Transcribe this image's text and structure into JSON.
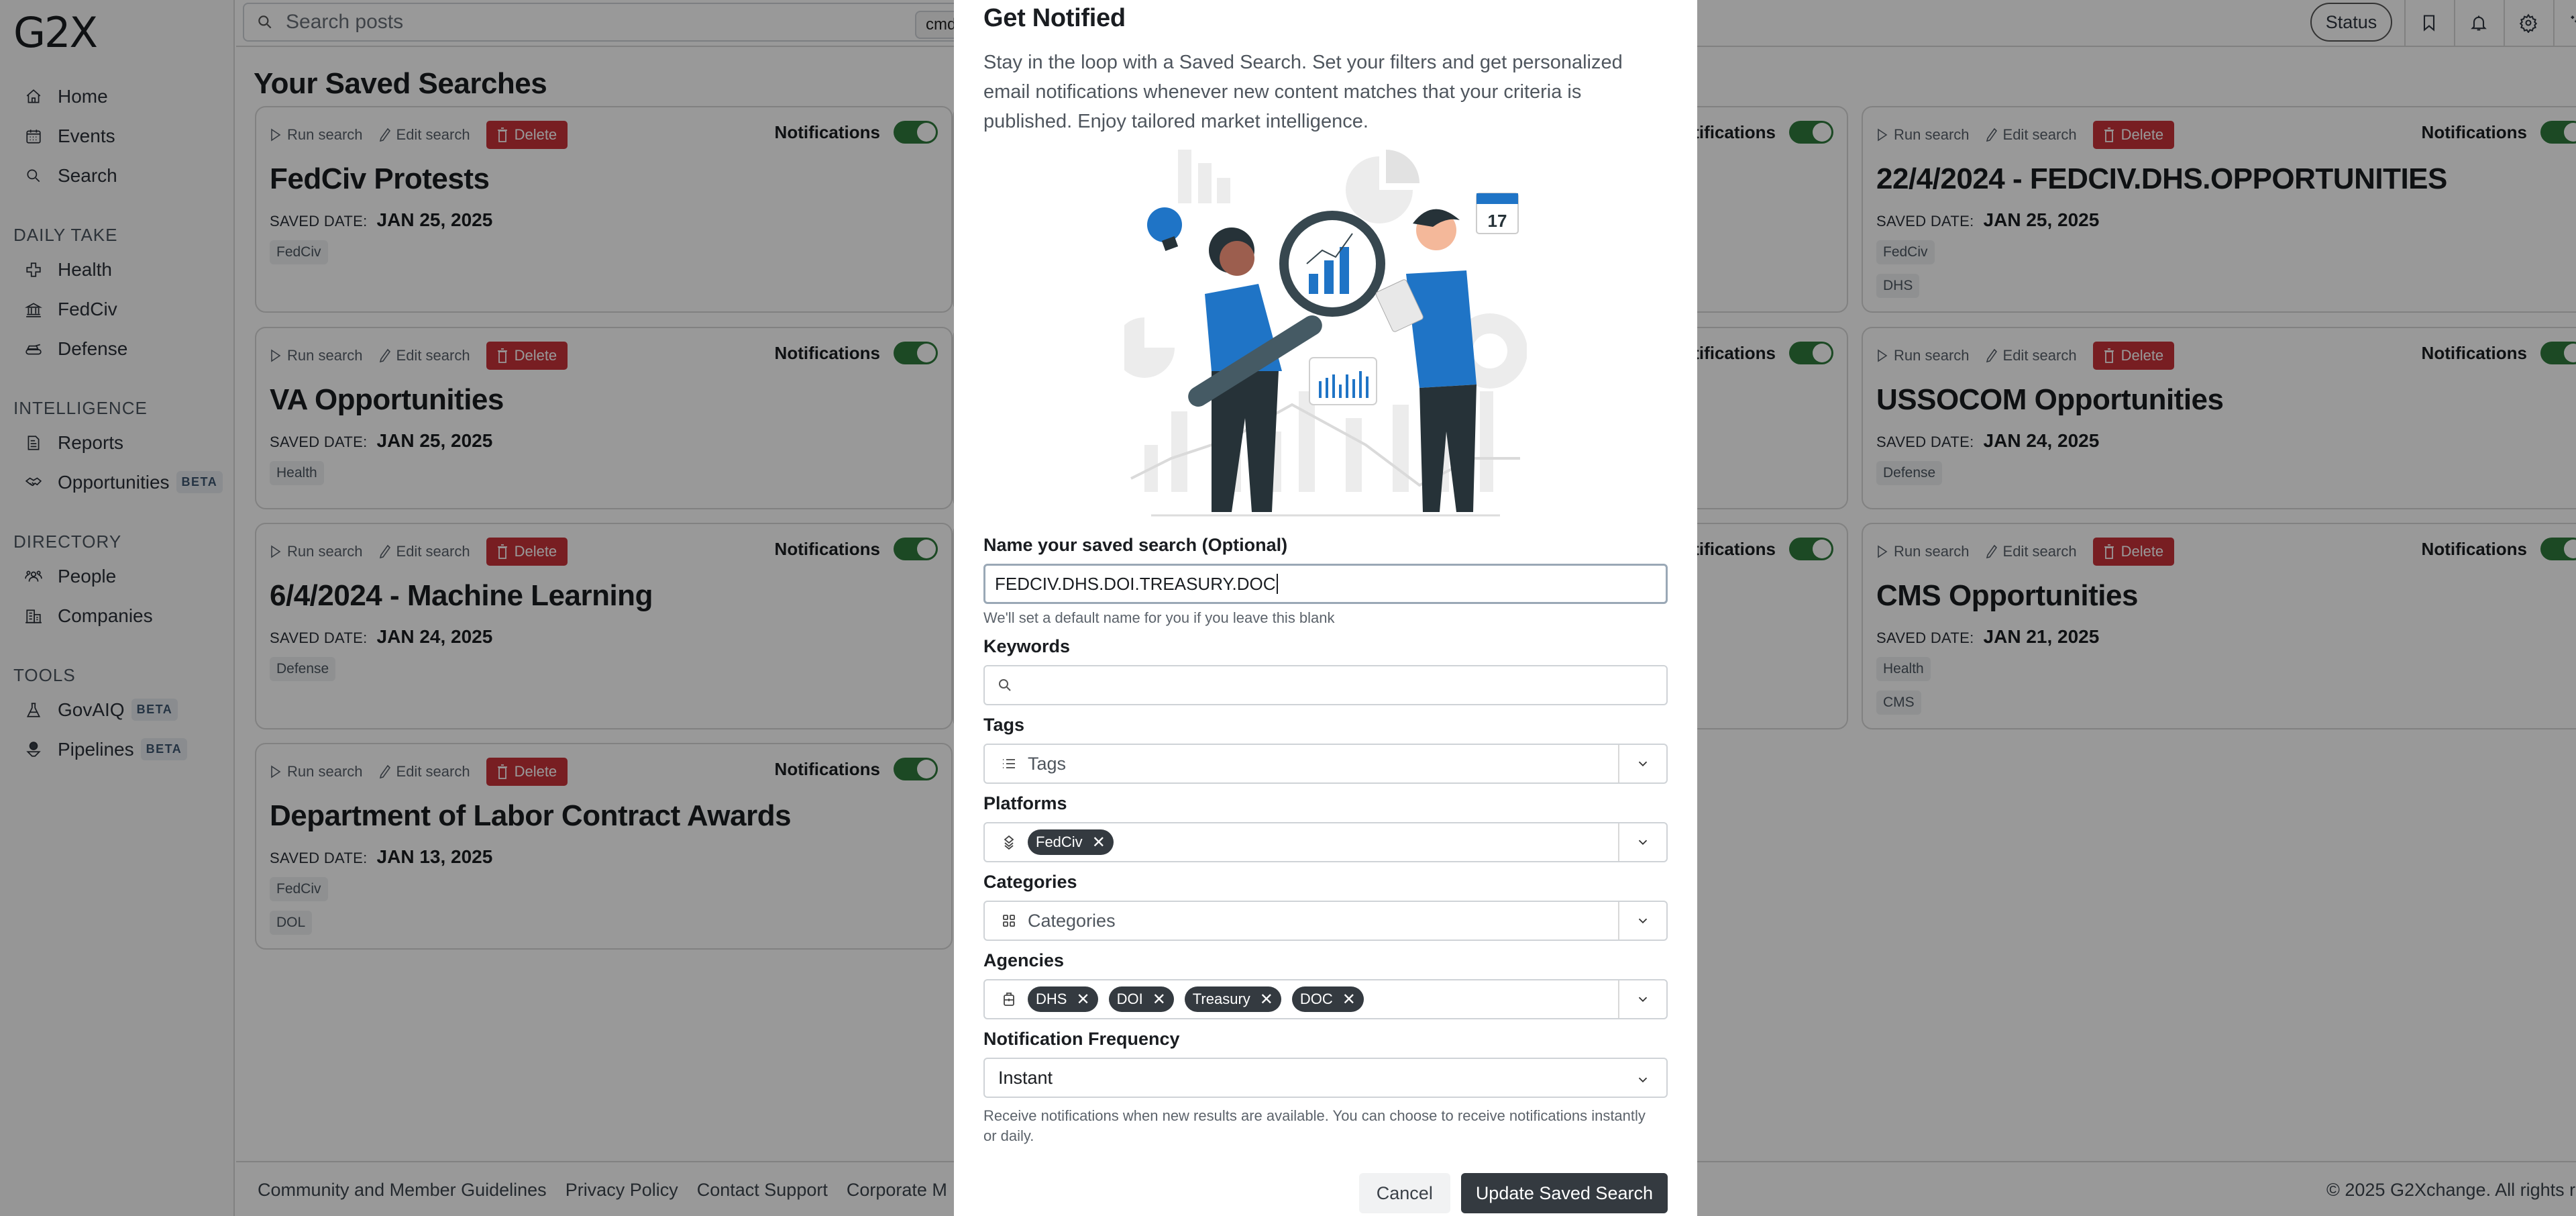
{
  "app": {
    "logo": "G2X"
  },
  "sidebar": {
    "top_items": [
      {
        "label": "Home",
        "icon": "home-icon"
      },
      {
        "label": "Events",
        "icon": "calendar-icon"
      },
      {
        "label": "Search",
        "icon": "search-icon"
      }
    ],
    "sections": [
      {
        "title": "DAILY TAKE",
        "items": [
          {
            "label": "Health",
            "icon": "health-cross-icon",
            "badge": ""
          },
          {
            "label": "FedCiv",
            "icon": "government-building-icon",
            "badge": ""
          },
          {
            "label": "Defense",
            "icon": "tank-icon",
            "badge": ""
          }
        ]
      },
      {
        "title": "INTELLIGENCE",
        "items": [
          {
            "label": "Reports",
            "icon": "document-icon",
            "badge": ""
          },
          {
            "label": "Opportunities",
            "icon": "handshake-icon",
            "badge": "BETA"
          }
        ]
      },
      {
        "title": "DIRECTORY",
        "items": [
          {
            "label": "People",
            "icon": "people-icon",
            "badge": ""
          },
          {
            "label": "Companies",
            "icon": "buildings-icon",
            "badge": ""
          }
        ]
      },
      {
        "title": "TOOLS",
        "items": [
          {
            "label": "GovAIQ",
            "icon": "flask-icon",
            "badge": "BETA"
          },
          {
            "label": "Pipelines",
            "icon": "dollar-funnel-icon",
            "badge": "BETA"
          }
        ]
      }
    ]
  },
  "header": {
    "search_placeholder": "Search posts",
    "shortcut": "cmd -",
    "status_label": "Status",
    "icons": [
      "bookmark-icon",
      "bell-icon",
      "gear-icon",
      "sparkles-icon"
    ]
  },
  "main": {
    "title": "Your Saved Searches",
    "run_label": "Run search",
    "edit_label": "Edit search",
    "delete_label": "Delete",
    "notifications_label": "Notifications",
    "saved_date_label": "SAVED DATE:",
    "cards": [
      {
        "title": "FedCiv Protests",
        "date": "JAN 25, 2025",
        "tags": [
          "FedCiv"
        ],
        "notifications_on": true
      },
      {
        "title": "VA Opportunities",
        "date": "JAN 25, 2025",
        "tags": [
          "Health"
        ],
        "notifications_on": true
      },
      {
        "title": "6/4/2024 - Machine Learning",
        "date": "JAN 24, 2025",
        "tags": [
          "Defense"
        ],
        "notifications_on": true
      },
      {
        "title": "Department of Labor Contract Awards",
        "date": "JAN 13, 2025",
        "tags": [
          "FedCiv",
          "DOL"
        ],
        "notifications_on": true
      },
      {
        "title": "22/4/2024 - FEDCIV.DHS.OPPORTUNITIES",
        "date": "JAN 25, 2025",
        "tags": [
          "FedCiv",
          "DHS"
        ],
        "notifications_on": true
      },
      {
        "title": "USSOCOM Opportunities",
        "date": "JAN 24, 2025",
        "tags": [
          "Defense"
        ],
        "notifications_on": true
      },
      {
        "title": "CMS Opportunities",
        "date": "JAN 21, 2025",
        "tags": [
          "Health",
          "CMS"
        ],
        "notifications_on": true
      }
    ],
    "hidden_middle_toggles": [
      true,
      true,
      true
    ]
  },
  "footer": {
    "links": [
      "Community and Member Guidelines",
      "Privacy Policy",
      "Contact Support",
      "Corporate M"
    ],
    "copyright": "© 2025 G2Xchange. All rights r"
  },
  "modal": {
    "title": "Get Notified",
    "description": "Stay in the loop with a Saved Search. Set your filters and get personalized email notifications whenever new content matches that your criteria is published. Enjoy tailored market intelligence.",
    "illustration": "people-analyzing-charts-illustration",
    "illustration_calendar_day": "17",
    "name_label": "Name your saved search (Optional)",
    "name_value": "FEDCIV.DHS.DOI.TREASURY.DOC",
    "name_hint": "We'll set a default name for you if you leave this blank",
    "keywords_label": "Keywords",
    "keywords_value": "",
    "tags_label": "Tags",
    "tags_placeholder": "Tags",
    "tags_selected": [],
    "platforms_label": "Platforms",
    "platforms_selected": [
      "FedCiv"
    ],
    "categories_label": "Categories",
    "categories_placeholder": "Categories",
    "agencies_label": "Agencies",
    "agencies_selected": [
      "DHS",
      "DOI",
      "Treasury",
      "DOC"
    ],
    "frequency_label": "Notification Frequency",
    "frequency_value": "Instant",
    "frequency_hint": "Receive notifications when new results are available. You can choose to receive notifications instantly or daily.",
    "cancel_label": "Cancel",
    "submit_label": "Update Saved Search",
    "chip_remove_glyph": "✕"
  },
  "colors": {
    "delete": "#c8323a",
    "toggle_on": "#2f7a3c",
    "chip": "#343a40",
    "illustration_blue": "#1f74c6"
  }
}
